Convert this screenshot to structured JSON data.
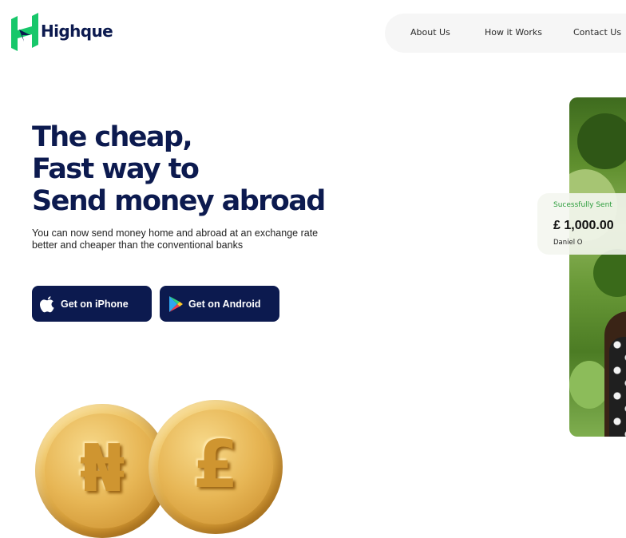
{
  "brand": {
    "name": "Highque",
    "logo_icon": "highque-logo-icon",
    "colors": {
      "primary": "#0c1a4f",
      "logo_green": "#17c76a",
      "success_green": "#2e9e3e"
    }
  },
  "nav": {
    "items": [
      {
        "label": "About Us"
      },
      {
        "label": "How it Works"
      },
      {
        "label": "Contact Us"
      }
    ]
  },
  "hero": {
    "title_lines": [
      "The cheap,",
      "Fast way to",
      "Send money abroad"
    ],
    "subtitle_lines": [
      "You can now send money home and abroad at an exchange rate",
      "better and cheaper than the conventional banks"
    ],
    "buttons": [
      {
        "label": "Get on iPhone",
        "icon": "apple-icon"
      },
      {
        "label": "Get on Android",
        "icon": "google-play-icon"
      }
    ]
  },
  "coins": [
    {
      "symbol": "₦",
      "icon": "naira-coin-icon"
    },
    {
      "symbol": "£",
      "icon": "pound-coin-icon"
    }
  ],
  "transfer_card": {
    "status": "Sucessfully Sent",
    "amount": "£ 1,000.00",
    "recipient": "Daniel O"
  }
}
